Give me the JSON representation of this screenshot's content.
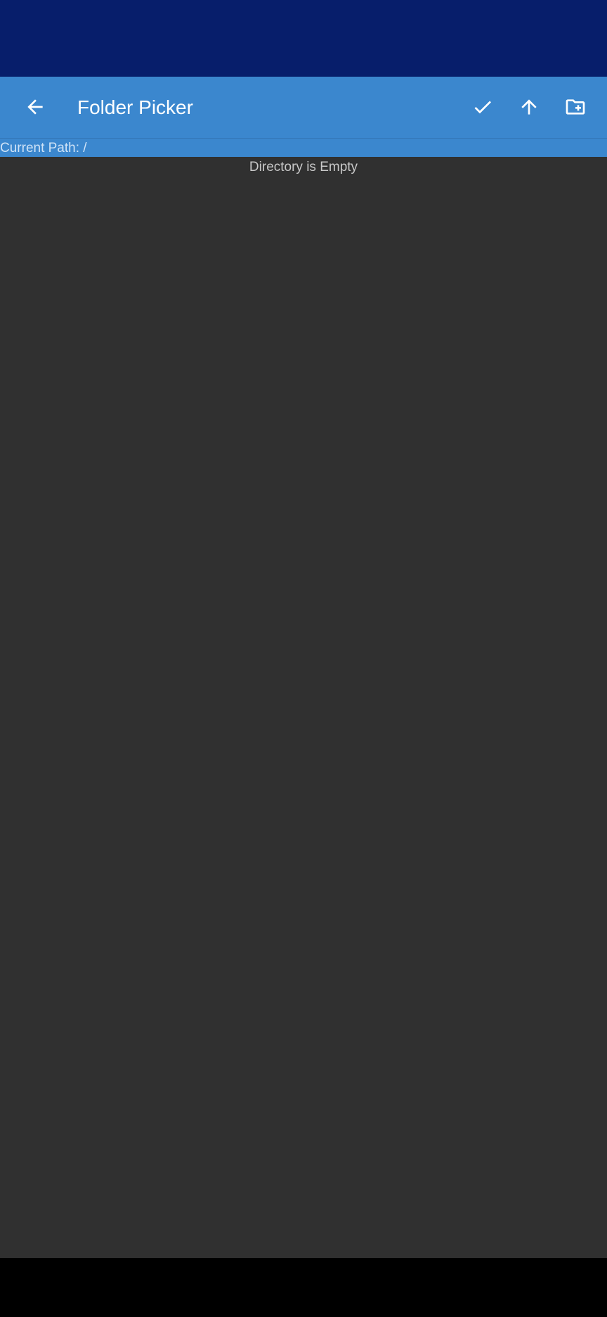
{
  "app_bar": {
    "title": "Folder Picker",
    "back_icon": "arrow-left-icon",
    "actions": [
      {
        "icon": "check-icon",
        "label": "Select"
      },
      {
        "icon": "arrow-up-icon",
        "label": "Up"
      },
      {
        "icon": "create-folder-icon",
        "label": "New Folder"
      }
    ]
  },
  "path_bar": {
    "text": "Current Path: /"
  },
  "content": {
    "empty_message": "Directory is Empty"
  },
  "colors": {
    "status_bar": "#071e6b",
    "app_bar": "#3b87ce",
    "background": "#303030",
    "nav_bar": "#000000"
  }
}
